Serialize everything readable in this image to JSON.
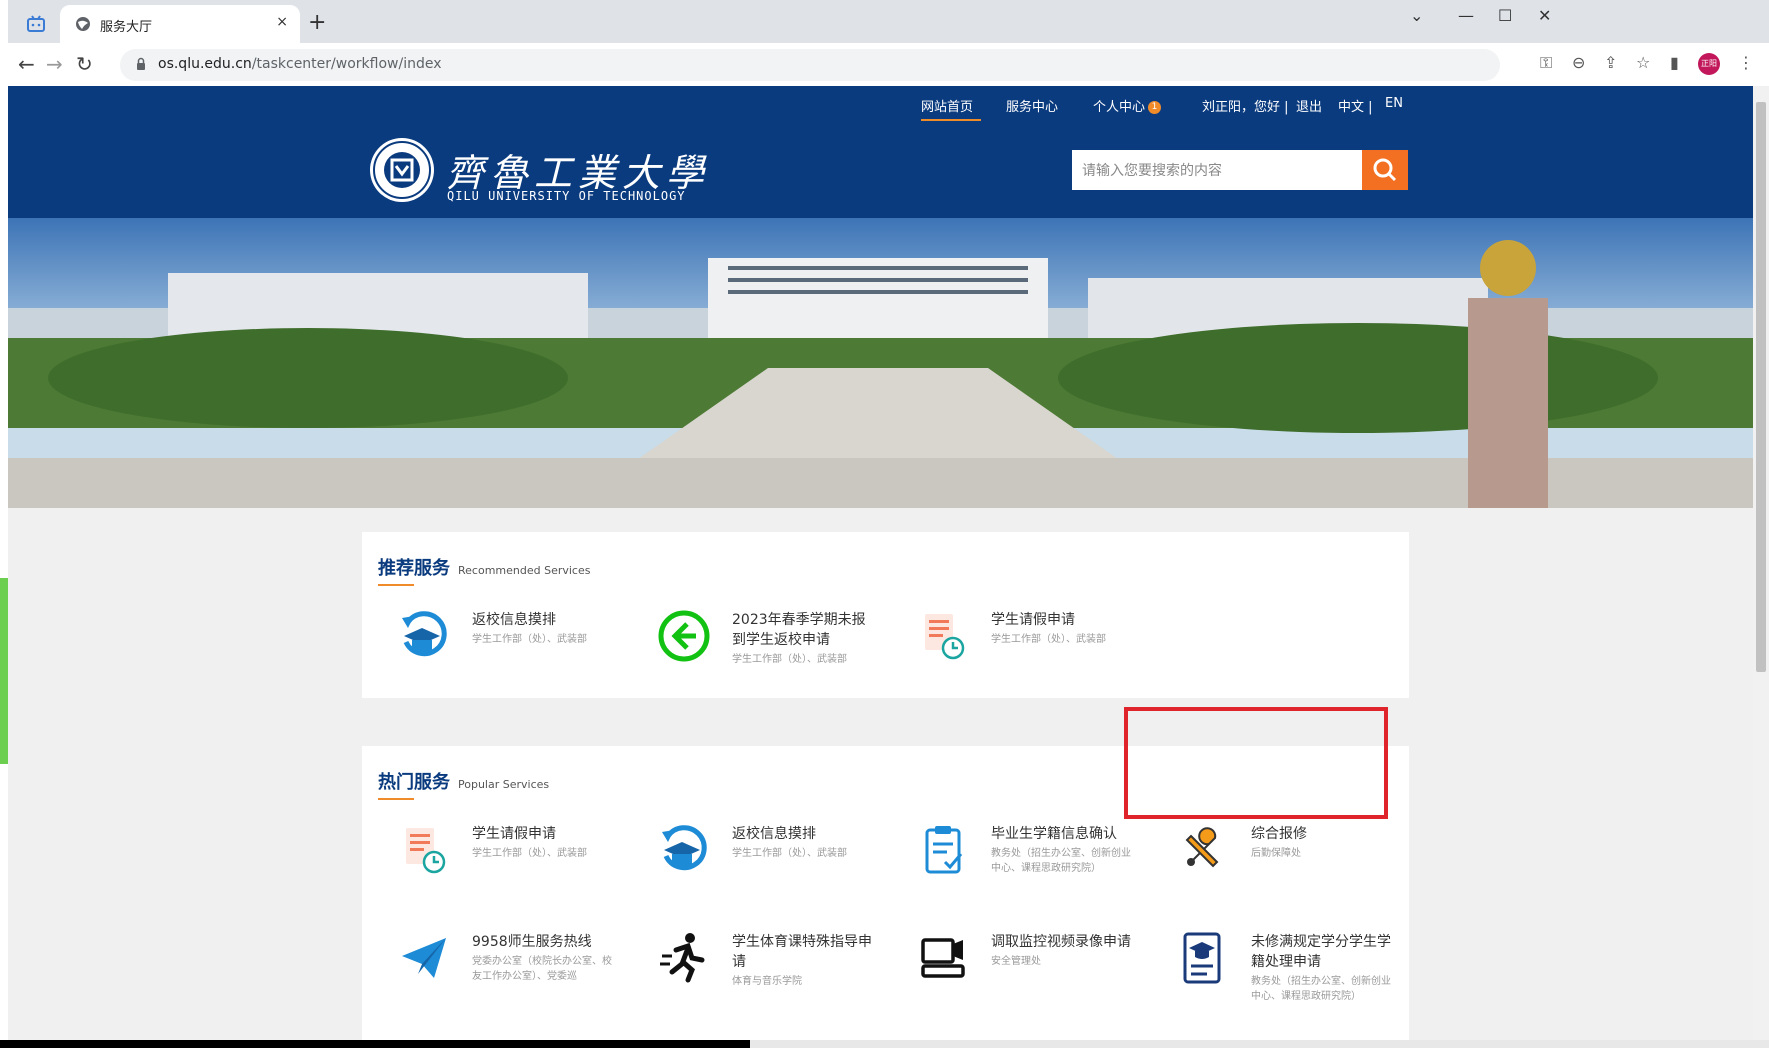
{
  "browser": {
    "tab_title": "服务大厅",
    "url_host": "os.qlu.edu.cn",
    "url_path": "/taskcenter/workflow/index",
    "profile_label": "正阳",
    "new_tab": "+",
    "tab_close": "×",
    "minimize": "—",
    "maximize": "☐",
    "close_window": "✕",
    "dropdown": "⌄"
  },
  "topnav": {
    "home": "网站首页",
    "service_center": "服务中心",
    "personal_center": "个人中心",
    "personal_badge": "1",
    "greeting": "刘正阳，您好 |",
    "logout": "退出",
    "lang_cn": "中文 |",
    "lang_en": "EN"
  },
  "header": {
    "logo_cn": "齊魯工業大學",
    "logo_en": "QILU UNIVERSITY OF TECHNOLOGY",
    "search_placeholder": "请输入您要搜索的内容"
  },
  "recommended": {
    "title": "推荐服务",
    "subtitle": "Recommended Services",
    "items": [
      {
        "name": "返校信息摸排",
        "dept": "学生工作部（处）、武装部",
        "icon": "graduation-cap-refresh-icon"
      },
      {
        "name": "2023年春季学期未报到学生返校申请",
        "dept": "学生工作部（处）、武装部",
        "icon": "arrow-left-circle-icon"
      },
      {
        "name": "学生请假申请",
        "dept": "学生工作部（处）、武装部",
        "icon": "document-clock-icon"
      }
    ]
  },
  "popular": {
    "title": "热门服务",
    "subtitle": "Popular Services",
    "items": [
      {
        "name": "学生请假申请",
        "dept": "学生工作部（处）、武装部",
        "icon": "document-clock-icon"
      },
      {
        "name": "返校信息摸排",
        "dept": "学生工作部（处）、武装部",
        "icon": "graduation-cap-refresh-icon"
      },
      {
        "name": "毕业生学籍信息确认",
        "dept": "教务处（招生办公室、创新创业中心、课程思政研究院）",
        "icon": "clipboard-check-icon"
      },
      {
        "name": "综合报修",
        "dept": "后勤保障处",
        "icon": "wrench-tools-icon"
      },
      {
        "name": "9958师生服务热线",
        "dept": "党委办公室（校院长办公室、校友工作办公室）、党委巡",
        "icon": "paper-plane-icon"
      },
      {
        "name": "学生体育课特殊指导申请",
        "dept": "体育与音乐学院",
        "icon": "running-person-icon"
      },
      {
        "name": "调取监控视频录像申请",
        "dept": "安全管理处",
        "icon": "monitor-camera-icon"
      },
      {
        "name": "未修满规定学分学生学籍处理申请",
        "dept": "教务处（招生办公室、创新创业中心、课程思政研究院）",
        "icon": "graduation-document-icon"
      }
    ]
  },
  "colors": {
    "brand_blue": "#0b3b7f",
    "accent_orange": "#f36f21",
    "highlight_red": "#e0242b"
  }
}
